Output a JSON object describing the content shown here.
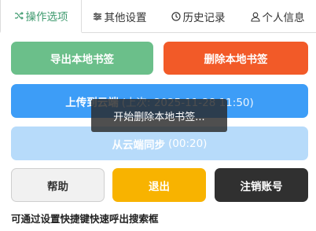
{
  "tabs": [
    {
      "label": "操作选项",
      "icon": "shuffle-icon",
      "active": true
    },
    {
      "label": "其他设置",
      "icon": "sliders-icon",
      "active": false
    },
    {
      "label": "历史记录",
      "icon": "clock-icon",
      "active": false
    },
    {
      "label": "个人信息",
      "icon": "user-icon",
      "active": false
    }
  ],
  "buttons": {
    "export_local": "导出本地书签",
    "delete_local": "删除本地书签",
    "upload_label": "上传到云端",
    "upload_last": "(上次: 2025-11-28 11:50)",
    "sync_label": "从云端同步",
    "sync_time": "(00:20)",
    "help": "帮助",
    "exit": "退出",
    "logout": "注销账号"
  },
  "toast": "开始删除本地书签...",
  "tip": "可通过设置快捷键快速呼出搜索框",
  "colors": {
    "accent_green": "#3e9a6e",
    "export": "#6bbf8a",
    "delete": "#f25a28",
    "upload": "#3d9df7",
    "sync": "#b7dbfa",
    "exit": "#f8b300",
    "logout": "#303030"
  }
}
